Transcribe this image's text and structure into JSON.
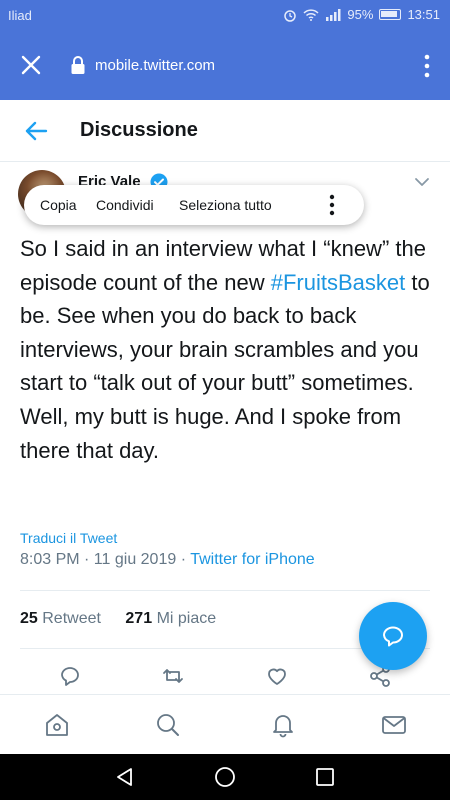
{
  "status_bar": {
    "carrier": "Iliad",
    "battery": "95%",
    "time": "13:51"
  },
  "browser": {
    "url": "mobile.twitter.com",
    "colors": {
      "toolbar": "#4a74d8"
    }
  },
  "header": {
    "title": "Discussione"
  },
  "tweet": {
    "author_partial": "Eric Vale",
    "text_part1": "So I said in an interview what I “knew” the episode count of the new ",
    "hashtag": "#FruitsBasket",
    "text_part2": " to be. See when you do back to back interviews, your brain scrambles and you start to “talk out of your butt” sometimes. Well, my butt is huge. And I spoke from there that day.",
    "translate_label": "Traduci il Tweet",
    "timestamp": "8:03 PM · 11 giu 2019 · ",
    "client": "Twitter for iPhone",
    "retweets_count": "25",
    "retweets_label": "Retweet",
    "likes_count": "271",
    "likes_label": "Mi piace"
  },
  "context_menu": {
    "copy": "Copia",
    "share": "Condividi",
    "select_all": "Seleziona tutto"
  },
  "colors": {
    "accent": "#1da1f2",
    "link": "#1b95e0",
    "muted": "#657786"
  }
}
